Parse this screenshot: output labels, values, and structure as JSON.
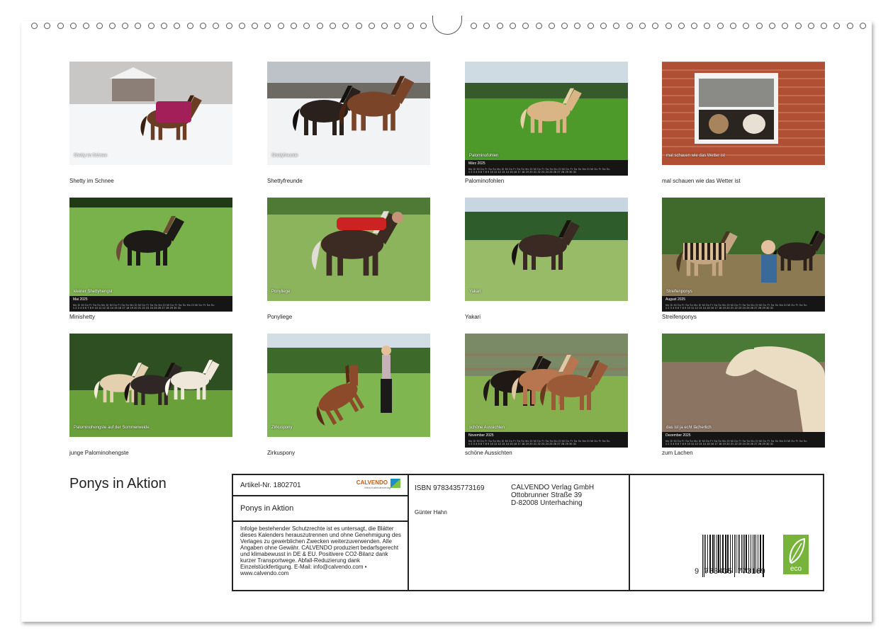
{
  "calendar": {
    "title": "Ponys in Aktion",
    "tiles": [
      {
        "label": "Shetty im Schnee",
        "caption": "Shetty im Schnee",
        "month": ""
      },
      {
        "label": "Shettyfreunde",
        "caption": "Shettyfreunde",
        "month": ""
      },
      {
        "label": "Palominofohlen",
        "caption": "Palominofohlen",
        "month": "März 2025"
      },
      {
        "label": "mal schauen wie das Wetter ist",
        "caption": "mal schauen wie das Wetter ist",
        "month": ""
      },
      {
        "label": "Minishetty",
        "caption": "kleiner Shettyhengst",
        "month": "Mai 2025"
      },
      {
        "label": "Ponyliege",
        "caption": "Ponyliege",
        "month": ""
      },
      {
        "label": "Yakari",
        "caption": "Yakari",
        "month": ""
      },
      {
        "label": "Streifenponys",
        "caption": "Streifenponys",
        "month": "August 2025"
      },
      {
        "label": "junge Palominohengste",
        "caption": "Palominohengste auf der Sommerweide",
        "month": ""
      },
      {
        "label": "Zirkuspony",
        "caption": "Zirkuspony",
        "month": ""
      },
      {
        "label": "schöne Aussichten",
        "caption": "schöne Aussichten",
        "month": "November 2025"
      },
      {
        "label": "zum Lachen",
        "caption": "das ist ja echt lächerlich",
        "month": "Dezember 2025"
      }
    ]
  },
  "info": {
    "article": "Artikel-Nr. 1802701",
    "brand": "CALVENDO",
    "brand_sub": "Mein Kalenderverlag",
    "title": "Ponys in Aktion",
    "legal": "Infolge bestehender Schutzrechte ist es untersagt, die Blätter dieses Kalenders herauszutrennen und ohne Genehmigung des Verlages zu gewerblichen Zwecken weiterzuverwenden. Alle Angaben ohne Gewähr. CALVENDO produziert bedarfsgerecht und klimabewusst in DE & EU. Positivere CO2-Bilanz dank kurzer Transportwege. Abfall-Reduzierung dank Einzelstückfertigung. E-Mail: info@calvendo.com • www.calvendo.com",
    "isbn": "ISBN 9783435773169",
    "author": "Günter Hahn",
    "publisher_line1": "CALVENDO Verlag GmbH",
    "publisher_line2": "Ottobrunner Straße 39",
    "publisher_line3": "D-82008 Unterhaching",
    "barcode_digits": "9  783435  773169",
    "eco_label": "eco"
  },
  "colors": {
    "frame": "#222222",
    "brand": "#c45a15",
    "eco": "#78b43c",
    "strip": "#151515"
  }
}
